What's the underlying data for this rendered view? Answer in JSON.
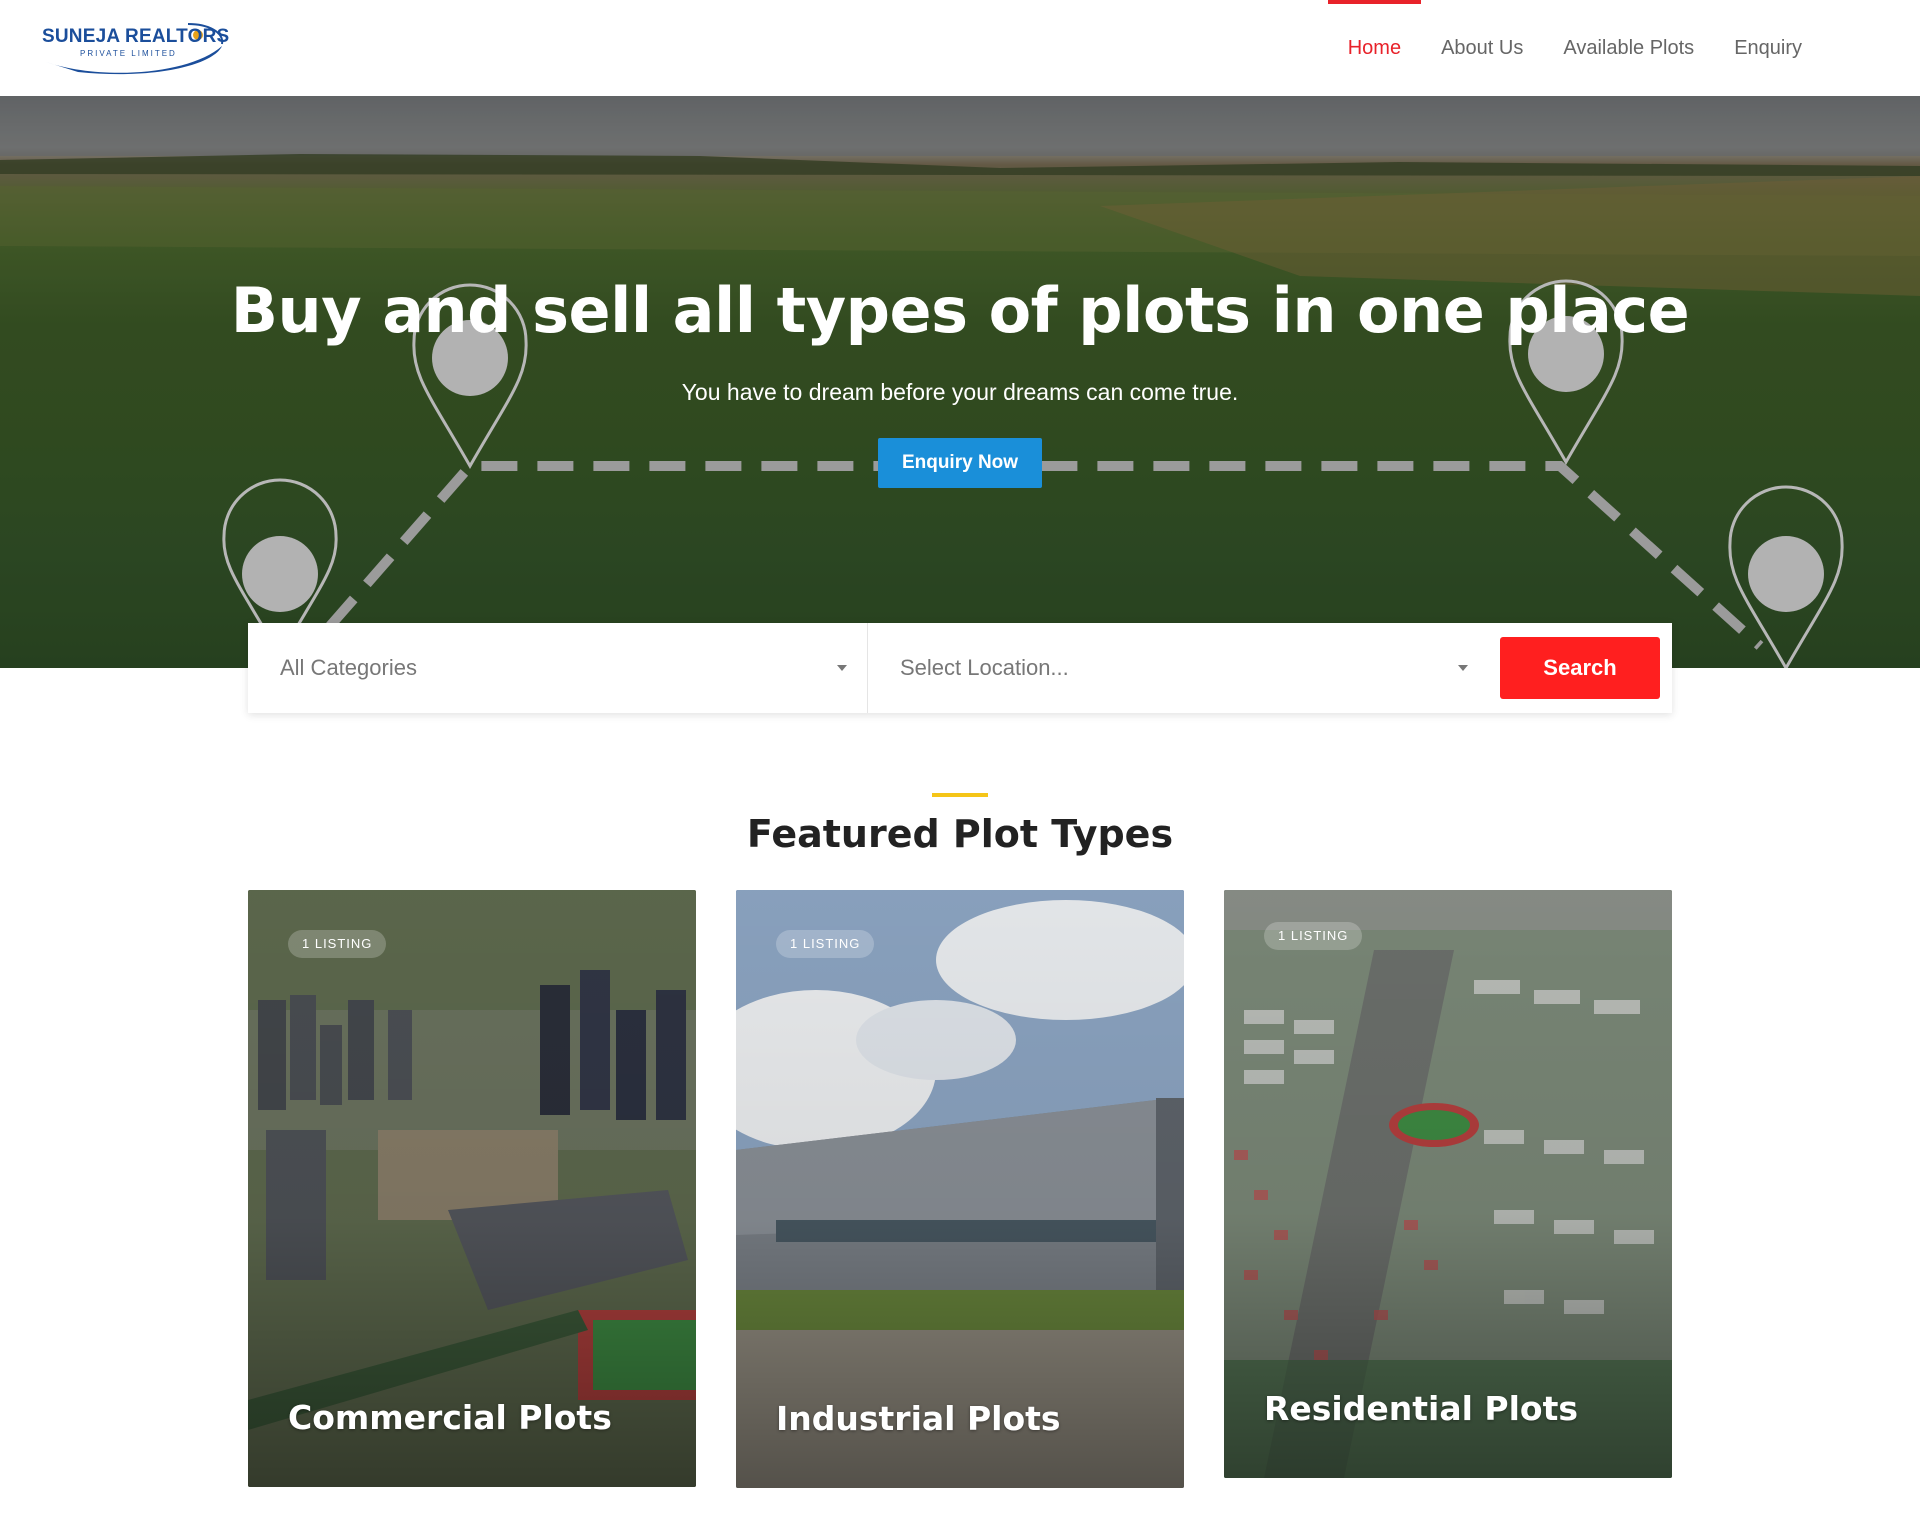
{
  "header": {
    "logo": {
      "name": "SUNEJA REALTORS",
      "subtitle": "PRIVATE LIMITED"
    },
    "nav": [
      {
        "label": "Home",
        "active": true
      },
      {
        "label": "About Us",
        "active": false
      },
      {
        "label": "Available Plots",
        "active": false
      },
      {
        "label": "Enquiry",
        "active": false
      }
    ]
  },
  "hero": {
    "title": "Buy and sell all types of plots in one place",
    "subtitle": "You have to dream before your dreams can come true.",
    "cta_label": "Enquiry Now"
  },
  "search": {
    "category_value": "All Categories",
    "location_placeholder": "Select Location...",
    "button_label": "Search"
  },
  "featured": {
    "title": "Featured Plot Types",
    "cards": [
      {
        "badge": "1 LISTING",
        "title": "Commercial Plots"
      },
      {
        "badge": "1 LISTING",
        "title": "Industrial Plots"
      },
      {
        "badge": "1 LISTING",
        "title": "Residential Plots"
      }
    ]
  },
  "colors": {
    "accent_red": "#e8222a",
    "search_button": "#ff1f1f",
    "cta_blue": "#1a8fd9",
    "title_accent": "#f5c518",
    "brand_blue": "#1b4e9b"
  },
  "icons": [
    "map-pin-icon",
    "caret-down-icon",
    "logo-swoosh-icon"
  ]
}
